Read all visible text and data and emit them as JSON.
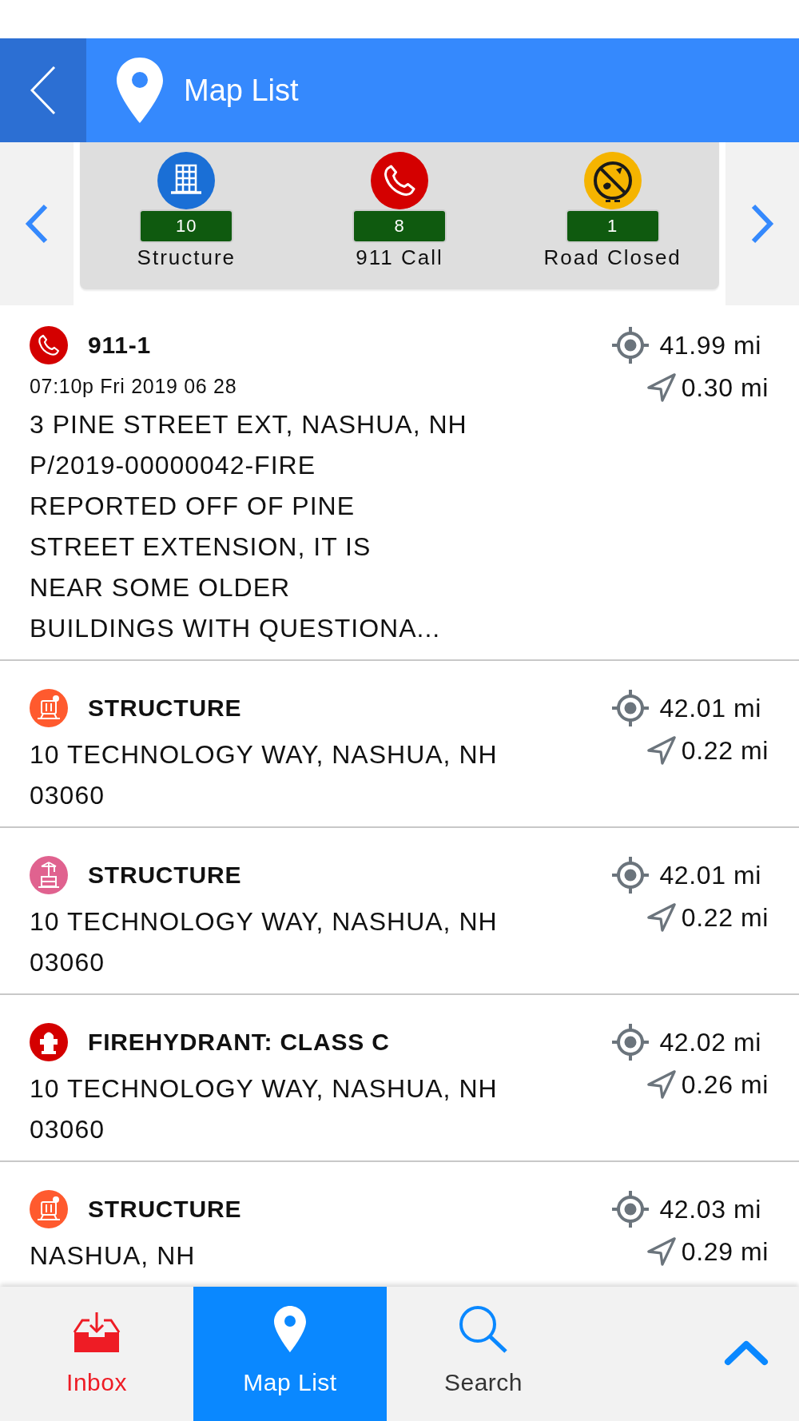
{
  "header": {
    "title": "Map List"
  },
  "categories": [
    {
      "kind": "structure",
      "count": "10",
      "label": "Structure"
    },
    {
      "kind": "call",
      "count": "8",
      "label": "911 Call"
    },
    {
      "kind": "road_closed",
      "count": "1",
      "label": "Road Closed"
    }
  ],
  "items": [
    {
      "kind": "call",
      "color": "#d40000",
      "title": "911-1",
      "time": "07:10p Fri 2019 06 28",
      "address": "3 PINE STREET EXT, NASHUA, NH",
      "incident": "P/2019-00000042-FIRE",
      "description": "REPORTED OFF OF PINE\nSTREET EXTENSION, IT IS\nNEAR SOME OLDER\nBUILDINGS WITH QUESTIONA...",
      "target_distance": "41.99 mi",
      "direction_distance": "0.30 mi"
    },
    {
      "kind": "structure",
      "color": "#ff5a2e",
      "title": "STRUCTURE",
      "address": "10 TECHNOLOGY WAY, NASHUA, NH 03060",
      "target_distance": "42.01 mi",
      "direction_distance": "0.22 mi"
    },
    {
      "kind": "tower",
      "color": "#e0628f",
      "title": "STRUCTURE",
      "address": "10 TECHNOLOGY WAY, NASHUA, NH 03060",
      "target_distance": "42.01 mi",
      "direction_distance": "0.22 mi"
    },
    {
      "kind": "hydrant",
      "color": "#d40000",
      "title": "FIREHYDRANT: CLASS C",
      "address": "10 TECHNOLOGY WAY, NASHUA, NH 03060",
      "target_distance": "42.02 mi",
      "direction_distance": "0.26 mi"
    },
    {
      "kind": "structure",
      "color": "#ff5a2e",
      "title": "STRUCTURE",
      "address": "NASHUA, NH",
      "target_distance": "42.03 mi",
      "direction_distance": "0.29 mi"
    }
  ],
  "nav": {
    "tabs": [
      {
        "kind": "inbox",
        "label": "Inbox",
        "selected": false
      },
      {
        "kind": "map",
        "label": "Map List",
        "selected": true
      },
      {
        "kind": "search",
        "label": "Search",
        "selected": false
      }
    ]
  }
}
